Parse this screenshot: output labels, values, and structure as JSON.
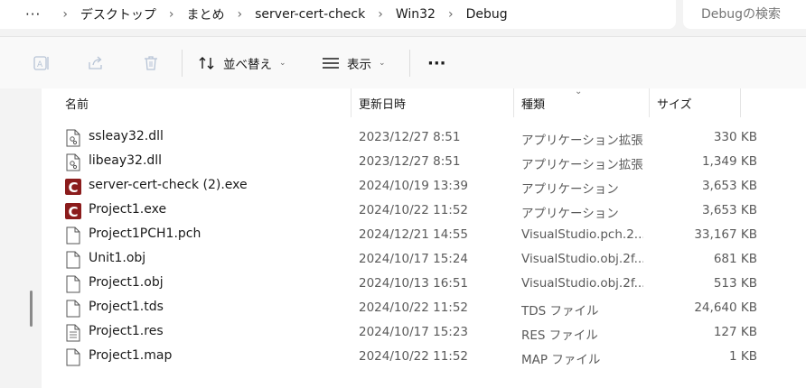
{
  "address": {
    "more": "···",
    "crumbs": [
      "デスクトップ",
      "まとめ",
      "server-cert-check",
      "Win32",
      "Debug"
    ]
  },
  "search": {
    "placeholder": "Debugの検索"
  },
  "toolbar": {
    "sort_label": "並べ替え",
    "view_label": "表示",
    "more": "···"
  },
  "columns": {
    "name": "名前",
    "date": "更新日時",
    "type": "種類",
    "size": "サイズ"
  },
  "files": [
    {
      "name": "ssleay32.dll",
      "date": "2023/12/27 8:51",
      "type": "アプリケーション拡張",
      "size": "330 KB",
      "icon": "dll-icon"
    },
    {
      "name": "libeay32.dll",
      "date": "2023/12/27 8:51",
      "type": "アプリケーション拡張",
      "size": "1,349 KB",
      "icon": "dll-icon"
    },
    {
      "name": "server-cert-check (2).exe",
      "date": "2024/10/19 13:39",
      "type": "アプリケーション",
      "size": "3,653 KB",
      "icon": "cpp-builder-exe-icon"
    },
    {
      "name": "Project1.exe",
      "date": "2024/10/22 11:52",
      "type": "アプリケーション",
      "size": "3,653 KB",
      "icon": "cpp-builder-exe-icon"
    },
    {
      "name": "Project1PCH1.pch",
      "date": "2024/12/21 14:55",
      "type": "VisualStudio.pch.2...",
      "size": "33,167 KB",
      "icon": "file-icon"
    },
    {
      "name": "Unit1.obj",
      "date": "2024/10/17 15:24",
      "type": "VisualStudio.obj.2f...",
      "size": "681 KB",
      "icon": "file-icon"
    },
    {
      "name": "Project1.obj",
      "date": "2024/10/13 16:51",
      "type": "VisualStudio.obj.2f...",
      "size": "513 KB",
      "icon": "file-icon"
    },
    {
      "name": "Project1.tds",
      "date": "2024/10/22 11:52",
      "type": "TDS ファイル",
      "size": "24,640 KB",
      "icon": "file-icon"
    },
    {
      "name": "Project1.res",
      "date": "2024/10/17 15:23",
      "type": "RES ファイル",
      "size": "127 KB",
      "icon": "text-file-icon"
    },
    {
      "name": "Project1.map",
      "date": "2024/10/22 11:52",
      "type": "MAP ファイル",
      "size": "1 KB",
      "icon": "file-icon"
    }
  ],
  "colors": {
    "exe_icon": "#8b1c1c",
    "accent": "#005fb8"
  }
}
